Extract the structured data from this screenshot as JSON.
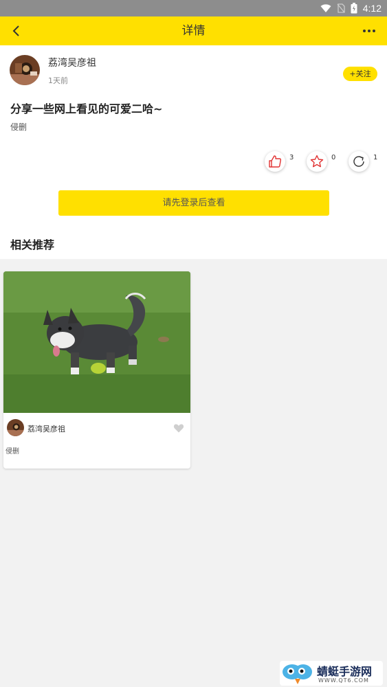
{
  "status_bar": {
    "time": "4:12"
  },
  "app_bar": {
    "title": "详情"
  },
  "post": {
    "author": "荔湾吴彦祖",
    "time_ago": "1天前",
    "follow_label": "+关注",
    "title": "分享一些网上看见的可爱二哈~",
    "body": "侵删",
    "likes": "3",
    "favorites": "0",
    "shares": "1"
  },
  "login_prompt": "请先登录后查看",
  "related": {
    "title": "相关推荐",
    "items": [
      {
        "author": "荔湾吴彦祖",
        "body": "侵删"
      }
    ]
  },
  "watermark": {
    "name": "蜻蜓手游网",
    "url": "WWW.QT6.COM"
  },
  "colors": {
    "accent": "#ffe000",
    "icon_red": "#e03030"
  }
}
